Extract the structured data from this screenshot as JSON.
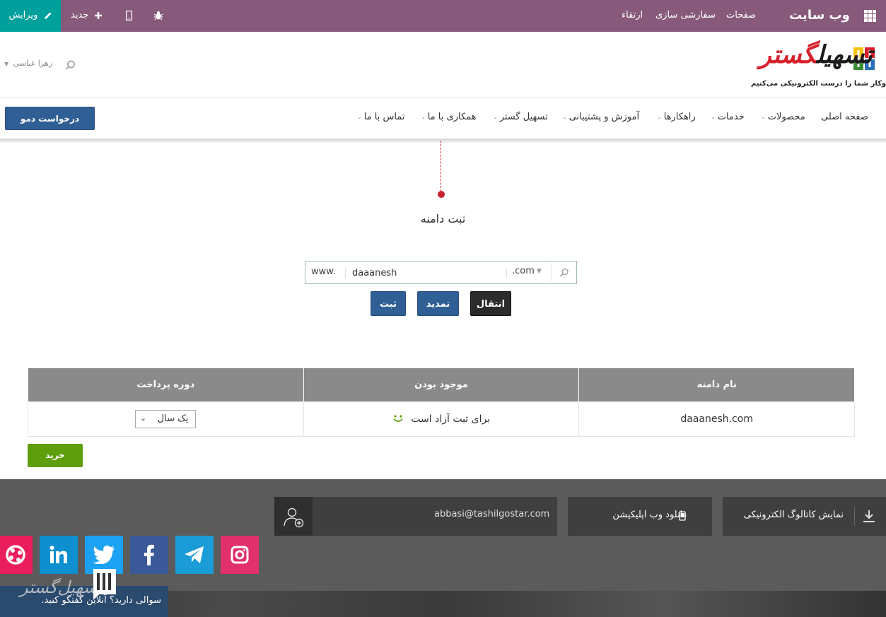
{
  "admin_bar": {
    "app_title": "وب سایت",
    "menu": [
      "صفحات",
      "سفارشی سازی",
      "ارتقاء"
    ],
    "new_label": "جدید",
    "edit_label": "ویرایش"
  },
  "header": {
    "logo_text_black": "تسهیل",
    "logo_text_red": "گستر",
    "tagline": "کسب‌وکار شما را درست الکترونیکی می‌کنیم",
    "user_name": "زهرا عباسی"
  },
  "nav": {
    "items": [
      {
        "label": "صفحه اصلی"
      },
      {
        "label": "محصولات"
      },
      {
        "label": "خدمات"
      },
      {
        "label": "راهکارها"
      },
      {
        "label": "آموزش و پشتیبانی"
      },
      {
        "label": "تسهیل گستر"
      },
      {
        "label": "همکاری با ما"
      },
      {
        "label": "تماس با ما"
      }
    ],
    "demo_button": "درخواست دمو"
  },
  "main": {
    "title": "ثبت دامنه",
    "search": {
      "prefix": "www.",
      "value": "daaanesh",
      "tld": ".com"
    },
    "buttons": {
      "transfer": "انتقال",
      "renew": "تمدید",
      "register": "ثبت"
    }
  },
  "table": {
    "headers": [
      "نام دامنه",
      "موجود بودن",
      "دوره پرداخت"
    ],
    "row": {
      "domain": "daaanesh.com",
      "status": "برای ثبت آزاد است",
      "period": "یک سال"
    }
  },
  "buy_label": "خرید",
  "footer": {
    "catalog": "نمایش کاتالوگ الکترونیکی",
    "webapp": "دانلود وب اپلیکیشن",
    "email": "abbasi@tashilgostar.com"
  },
  "chat": {
    "text": "سوالی دارید؟ آنلاین گفتگو کنید."
  },
  "colors": {
    "admin_bar": "#875a7b",
    "edit_button": "#00a09d",
    "primary_blue": "#2f5f94",
    "buy_green": "#5e9e0c",
    "brand_red": "#d6202b"
  },
  "icons": {
    "apps": "apps-grid-icon",
    "new": "plus-icon",
    "edit": "pencil-icon",
    "mobile": "mobile-icon",
    "debug": "bug-icon",
    "search": "search-icon",
    "download": "download-icon",
    "add_user": "add-user-icon",
    "social": [
      "instagram-icon",
      "telegram-icon",
      "facebook-icon",
      "twitter-icon",
      "linkedin-icon",
      "aparat-icon"
    ]
  }
}
